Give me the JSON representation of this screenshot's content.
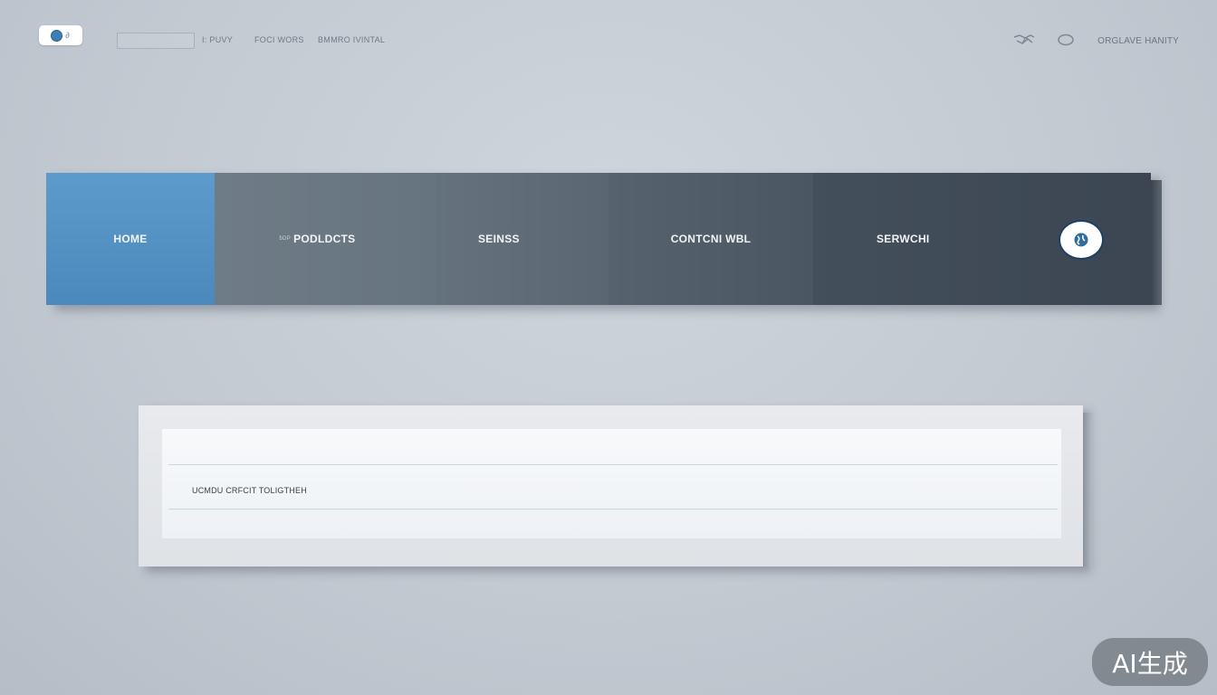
{
  "header": {
    "search_placeholder": "",
    "links": [
      "I: PUVY",
      "FOCI WORS",
      "BMMRO IVINTAL"
    ],
    "user_label": "ORGLAVE HANITY"
  },
  "nav": {
    "items": [
      {
        "label": "HOME"
      },
      {
        "prefix": "ƀDP",
        "label": "PODLDCTS"
      },
      {
        "label": "SEINSS"
      },
      {
        "label": "CONTCNI WBL"
      },
      {
        "label": "SERWCHI"
      }
    ],
    "active": "HOME"
  },
  "card": {
    "text": "UCMDU CRFCIT TOLIGTHEH"
  },
  "watermark": "AI生成",
  "colors": {
    "accent": "#4b89bc",
    "nav_dark": "#3b4652",
    "search_ring": "#1d3f66"
  }
}
